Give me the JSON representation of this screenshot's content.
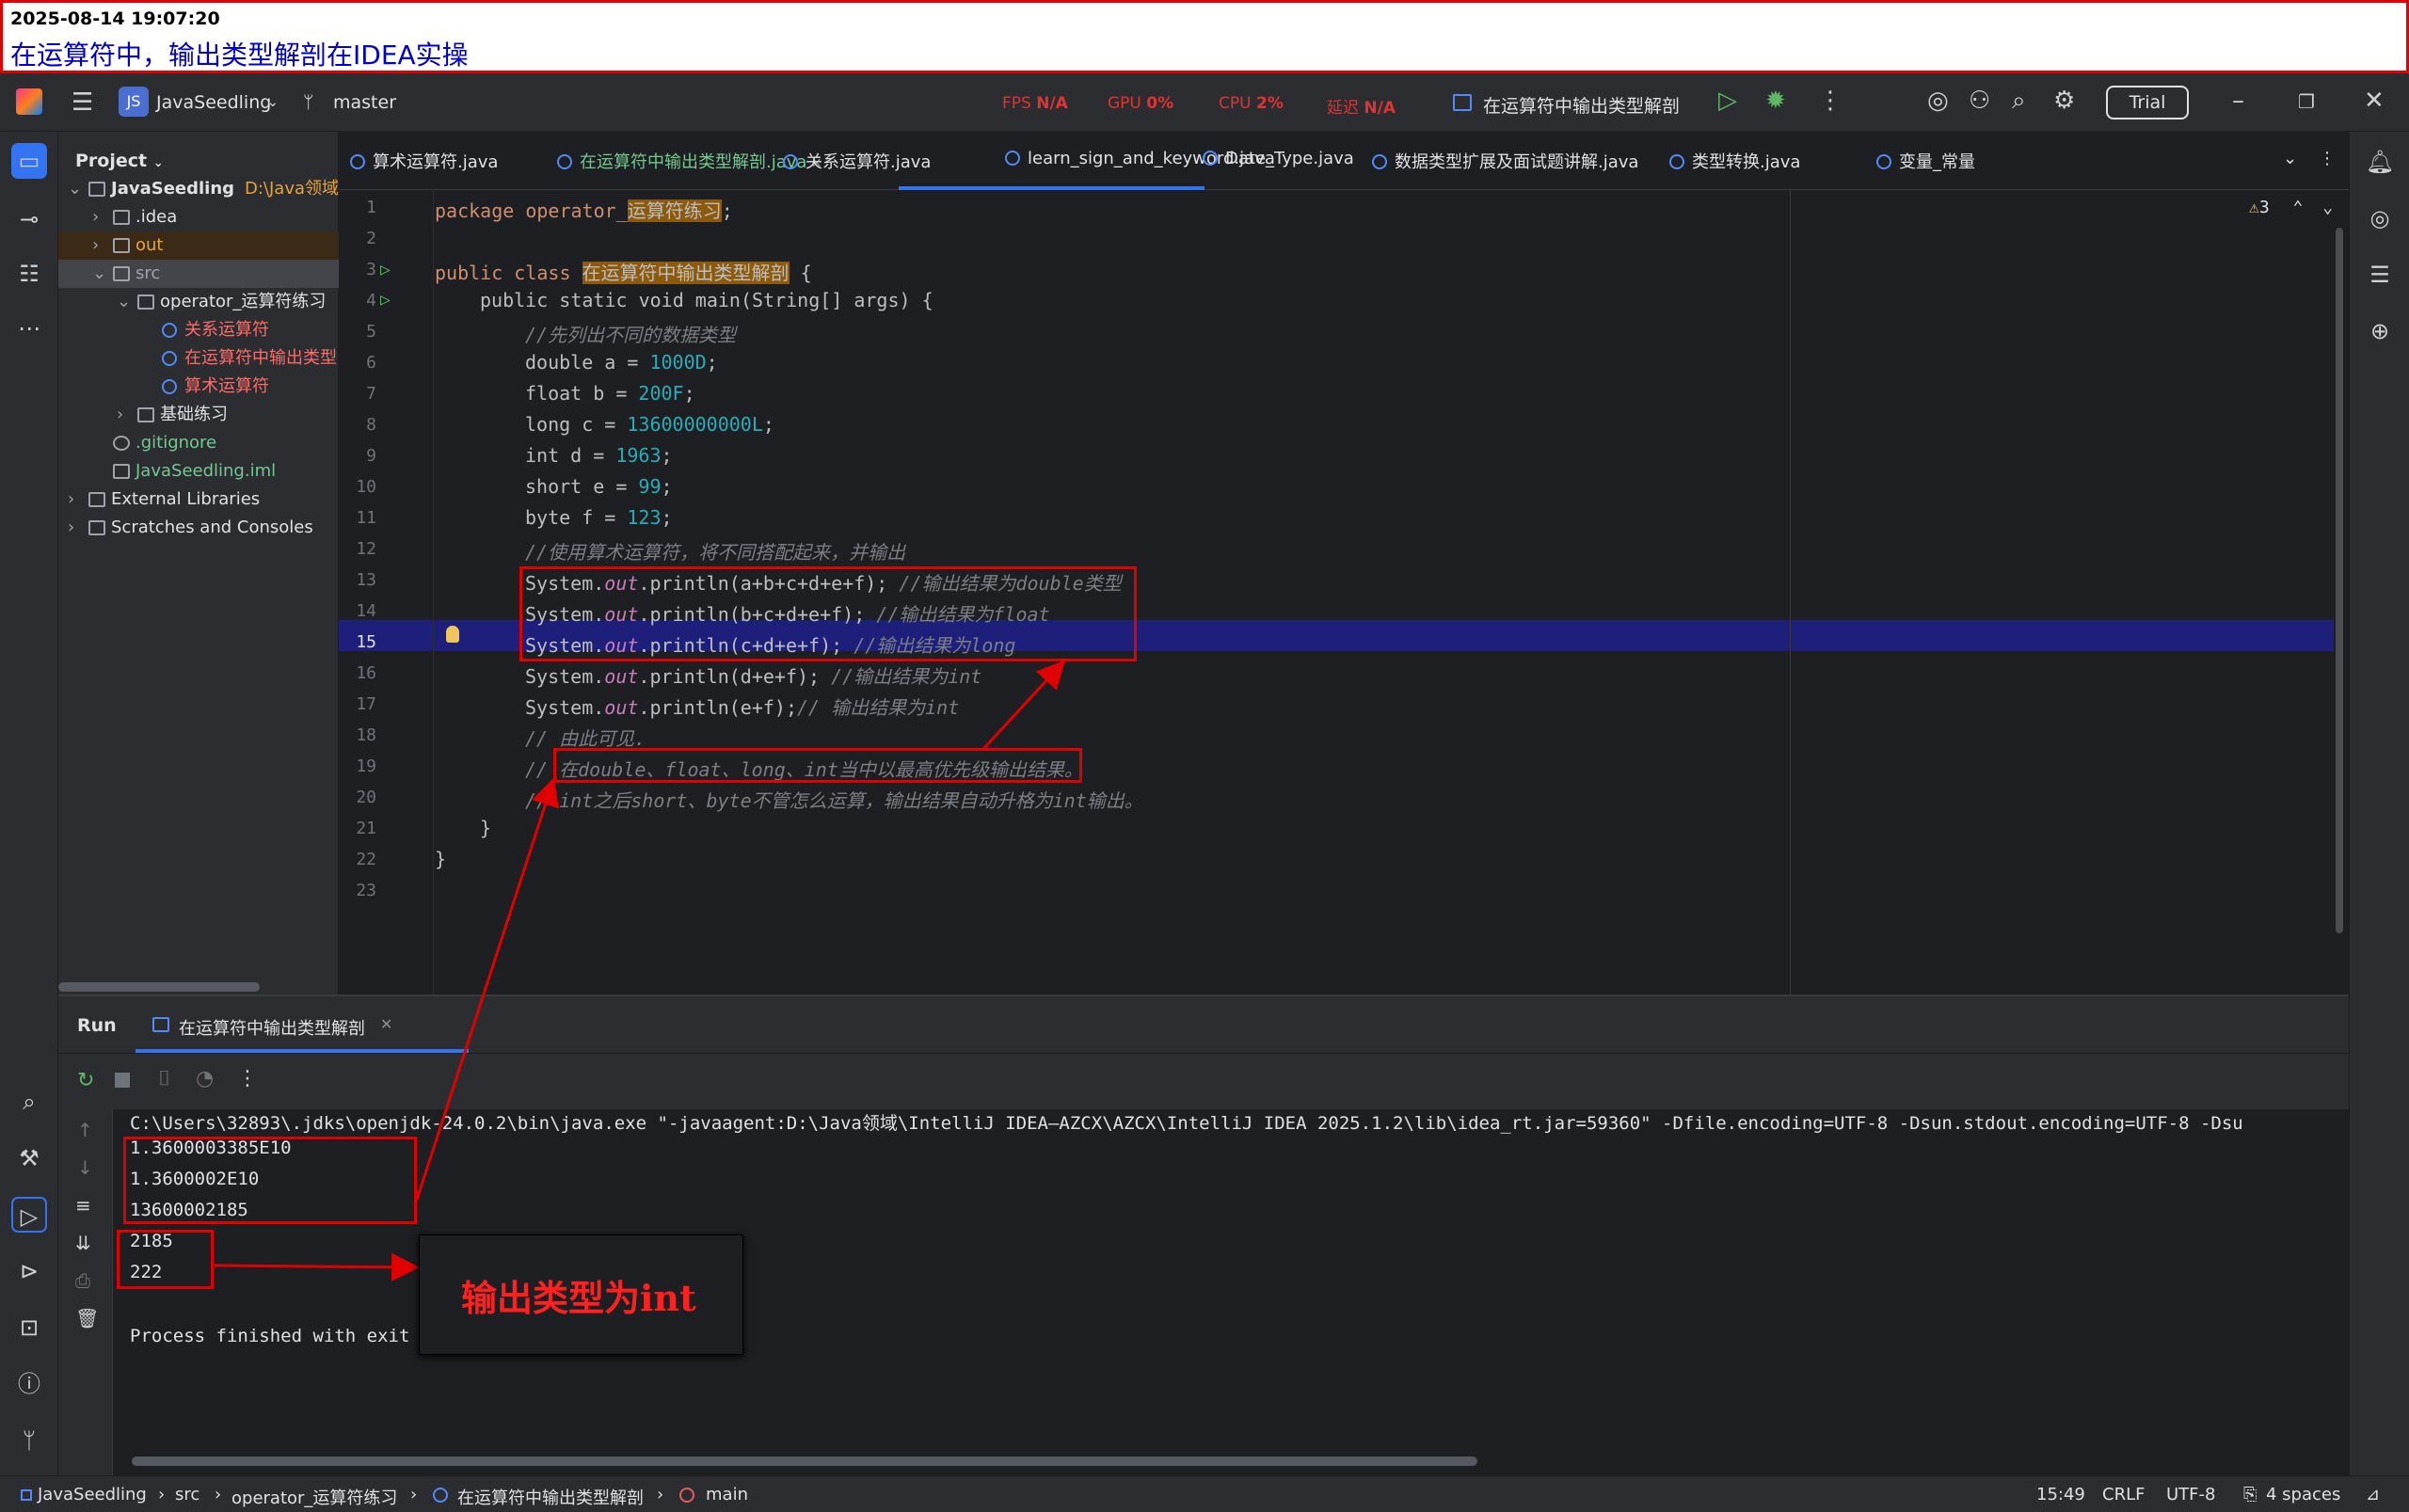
{
  "note": {
    "timestamp": "2025-08-14 19:07:20",
    "title": "在运算符中，输出类型解剖在IDEA实操"
  },
  "titlebar": {
    "project": "JavaSeedling",
    "project_badge": "JS",
    "branch": "master",
    "fps_label": "FPS",
    "fps": "N/A",
    "gpu_label": "GPU",
    "gpu": "0%",
    "cpu_label": "CPU",
    "cpu": "2%",
    "latency_label": "延迟",
    "latency": "N/A",
    "run_config": "在运算符中输出类型解剖",
    "trial": "Trial"
  },
  "project_panel": {
    "header": "Project",
    "tree": [
      {
        "label": "JavaSeedling",
        "extra": "D:\\Java领域\\",
        "level": 0,
        "icon": "module-folder-icon"
      },
      {
        "label": ".idea",
        "level": 1,
        "icon": "folder-icon"
      },
      {
        "label": "out",
        "level": 1,
        "icon": "folder-icon"
      },
      {
        "label": "src",
        "level": 1,
        "icon": "folder-icon"
      },
      {
        "label": "operator_运算符练习",
        "level": 2,
        "icon": "package-icon"
      },
      {
        "label": "关系运算符",
        "level": 3,
        "icon": "java-class-icon"
      },
      {
        "label": "在运算符中输出类型",
        "level": 3,
        "icon": "java-class-icon"
      },
      {
        "label": "算术运算符",
        "level": 3,
        "icon": "java-class-icon"
      },
      {
        "label": "基础练习",
        "level": 2,
        "icon": "package-icon"
      },
      {
        "label": ".gitignore",
        "level": 1,
        "icon": "gitignore-icon"
      },
      {
        "label": "JavaSeedling.iml",
        "level": 1,
        "icon": "iml-icon"
      },
      {
        "label": "External Libraries",
        "level": 0,
        "icon": "library-icon"
      },
      {
        "label": "Scratches and Consoles",
        "level": 0,
        "icon": "scratches-icon"
      }
    ]
  },
  "tabs": [
    "算术运算符.java",
    "在运算符中输出类型解剖.java",
    "关系运算符.java",
    "learn_sign_and_keyword.java",
    "Date_Type.java",
    "数据类型扩展及面试题讲解.java",
    "类型转换.java",
    "变量_常量"
  ],
  "editor": {
    "warnings": "3",
    "current_line": "15",
    "lines": [
      "1",
      "2",
      "3",
      "4",
      "5",
      "6",
      "7",
      "8",
      "9",
      "10",
      "11",
      "12",
      "13",
      "14",
      "15",
      "16",
      "17",
      "18",
      "19",
      "20",
      "21",
      "22",
      "23"
    ]
  },
  "code": {
    "l1a": "package operator_",
    "l1b": "运算符练习",
    "l3a": "public class ",
    "l3b": "在运算符中输出类型解剖",
    "l4": "public static void main(String[] args) {",
    "l5": "//先列出不同的数据类型",
    "l6a": "double a = ",
    "l6b": "1000D",
    "l7a": "float b = ",
    "l7b": "200F",
    "l8a": "long c = ",
    "l8b": "13600000000L",
    "l9a": "int d = ",
    "l9b": "1963",
    "l10a": "short e = ",
    "l10b": "99",
    "l11a": "byte f = ",
    "l11b": "123",
    "l12": "//使用算术运算符，将不同搭配起来，并输出",
    "l13a": "System.",
    "l13b": "out",
    "l13c": ".println(a+b+c+d+e+f); ",
    "l13d": "//输出结果为double类型",
    "l14a": "System.",
    "l14b": "out",
    "l14c": ".println(b+c+d+e+f); ",
    "l14d": "//输出结果为float",
    "l15a": "System.",
    "l15b": "out",
    "l15c": ".println(c+d+e+f); ",
    "l15d": "//输出结果为long",
    "l16a": "System.",
    "l16b": "out",
    "l16c": ".println(d+e+f); ",
    "l16d": "//输出结果为int",
    "l17a": "System.",
    "l17b": "out",
    "l17c": ".println(e+f);",
    "l17d": "// 输出结果为int",
    "l18": "// 由此可见.",
    "l19a": "// ",
    "l19b": "在double、float、long、int当中以最高优先级输出结果。",
    "l20": "// int之后short、byte不管怎么运算，输出结果自动升格为int输出。"
  },
  "run": {
    "title": "Run",
    "tab": "在运算符中输出类型解剖",
    "cmd": "C:\\Users\\32893\\.jdks\\openjdk-24.0.2\\bin\\java.exe \"-javaagent:D:\\Java领域\\IntelliJ IDEA—AZCX\\AZCX\\IntelliJ IDEA 2025.1.2\\lib\\idea_rt.jar=59360\" -Dfile.encoding=UTF-8 -Dsun.stdout.encoding=UTF-8 -Dsu",
    "outputs": [
      "1.3600003385E10",
      "1.3600002E10",
      "13600002185",
      "2185",
      "222"
    ],
    "finished": "Process finished with exit"
  },
  "annotation": "输出类型为int",
  "status": {
    "crumbs": [
      "JavaSeedling",
      "src",
      "operator_运算符练习",
      "在运算符中输出类型解剖",
      "main"
    ],
    "pos": "15:49",
    "eol": "CRLF",
    "enc": "UTF-8",
    "indent": "4 spaces"
  },
  "colors": {
    "accent": "#3574f0",
    "annotation": "#e00000",
    "bg": "#1e1f22"
  }
}
